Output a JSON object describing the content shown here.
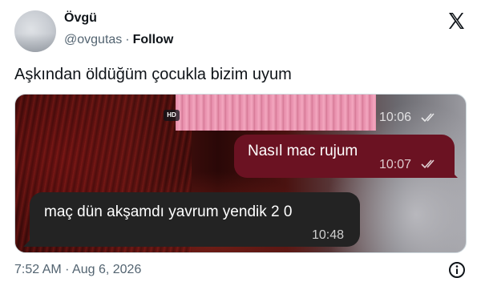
{
  "author": {
    "display_name": "Övgü",
    "handle": "@ovgutas",
    "separator": "·",
    "follow_label": "Follow"
  },
  "tweet": {
    "text": "Aşkından öldüğüm çocukla bizim uyum"
  },
  "media": {
    "hd_badge": "HD",
    "chat": {
      "bubble_top_time": "10:06",
      "outgoing": {
        "text": "Nasıl mac rujum",
        "time": "10:07"
      },
      "incoming": {
        "text": "maç dün akşamdı yavrum yendik 2 0",
        "time": "10:48"
      },
      "outgoing_color": "#6b1222",
      "incoming_color": "#232323"
    }
  },
  "footer": {
    "timestamp": "7:52 AM · Aug 6, 2026"
  },
  "icons": {
    "platform": "x-logo-icon",
    "info": "info-icon",
    "read_receipt": "double-check-icon"
  }
}
